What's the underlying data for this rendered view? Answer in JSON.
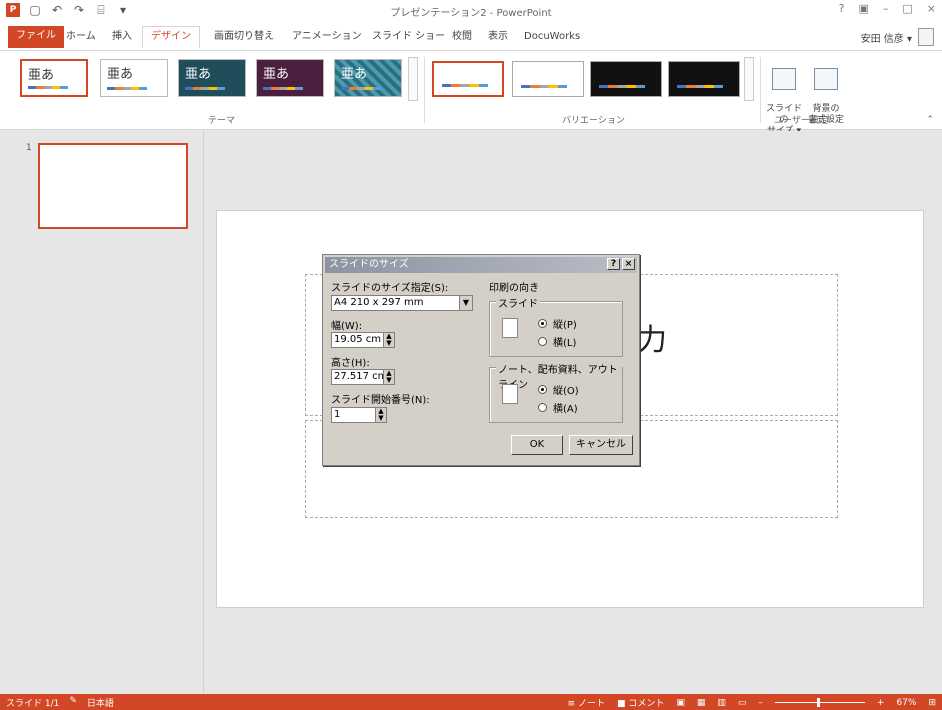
{
  "title_bar": {
    "document_title": "プレゼンテーション2 - PowerPoint",
    "app_icon_label": "P",
    "qat_icons": [
      "save-icon",
      "undo-icon",
      "redo-icon",
      "start-from-beginning-icon",
      "customize-qat-icon"
    ],
    "window_controls": [
      "?",
      "▣",
      "–",
      "□",
      "×"
    ]
  },
  "tabs": {
    "file": "ファイル",
    "items": [
      "ホーム",
      "挿入",
      "デザイン",
      "画面切り替え",
      "アニメーション",
      "スライド ショー",
      "校閲",
      "表示",
      "DocuWorks"
    ],
    "active": "デザイン",
    "user_name": "安田 信彦 ▾"
  },
  "ribbon": {
    "themes_group_label": "テーマ",
    "theme_labels": [
      "亜あ",
      "亜あ",
      "亜あ",
      "亜あ",
      "亜あ"
    ],
    "variations_group_label": "バリエーション",
    "user_settings_group_label": "ユーザー設定",
    "slide_size_button": "スライドの\nサイズ ▾",
    "background_format_button": "背景の\n書式設定",
    "colors": {
      "accent": "#d24726",
      "theme3_bg": "#1f4e5a",
      "theme4_bg": "#4a1f3f",
      "theme5_bg": "#2a6f80"
    }
  },
  "thumbnails": {
    "slide_number": "1"
  },
  "slide": {
    "title_placeholder_fragment": "入力"
  },
  "dialog": {
    "title": "スライドのサイズ",
    "help_button": "?",
    "close_button": "×",
    "size_label": "スライドのサイズ指定(S):",
    "size_value": "A4 210 x 297 mm",
    "width_label": "幅(W):",
    "width_value": "19.05 cm",
    "height_label": "高さ(H):",
    "height_value": "27.517 cm",
    "start_number_label": "スライド開始番号(N):",
    "start_number_value": "1",
    "orientation_group": "印刷の向き",
    "slides_group": "スライド",
    "slides_portrait": "縦(P)",
    "slides_landscape": "横(L)",
    "notes_group": "ノート、配布資料、アウトライン",
    "notes_portrait": "縦(O)",
    "notes_landscape": "横(A)",
    "ok": "OK",
    "cancel": "キャンセル"
  },
  "status_bar": {
    "slide_counter": "スライド 1/1",
    "language": "日本語",
    "notes": "≡ ノート",
    "comments": "■ コメント",
    "zoom_minus": "–",
    "zoom_plus": "+",
    "zoom_level": "67%",
    "zoom_fraction": 0.47
  }
}
